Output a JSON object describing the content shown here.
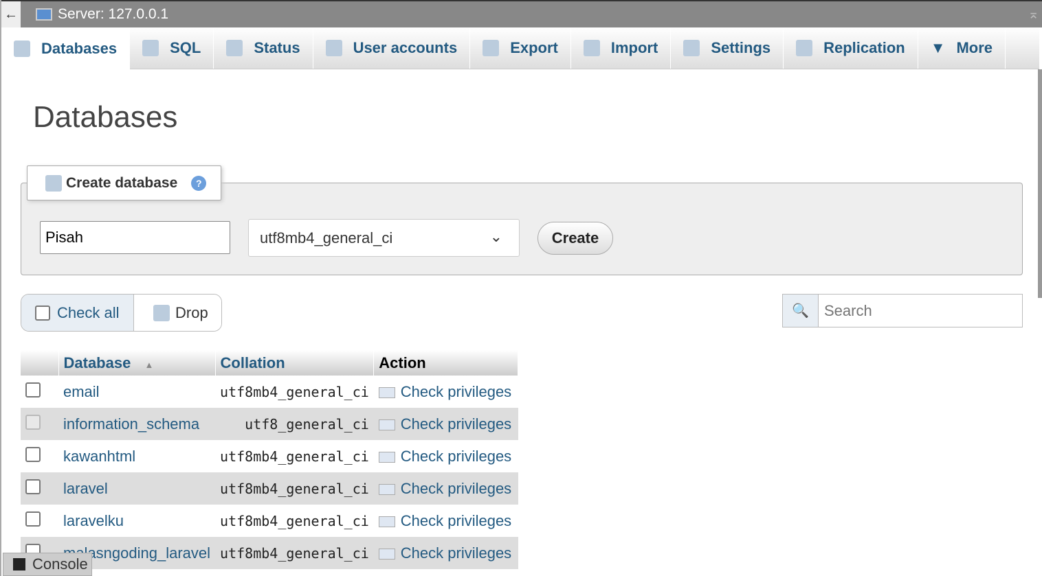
{
  "topbar": {
    "back": "←",
    "title": "Server: 127.0.0.1",
    "collapse": "⌅"
  },
  "tabs": [
    {
      "label": "Databases"
    },
    {
      "label": "SQL"
    },
    {
      "label": "Status"
    },
    {
      "label": "User accounts"
    },
    {
      "label": "Export"
    },
    {
      "label": "Import"
    },
    {
      "label": "Settings"
    },
    {
      "label": "Replication"
    },
    {
      "label": "More"
    }
  ],
  "page_title": "Databases",
  "create": {
    "legend": "Create database",
    "help": "?",
    "name_value": "Pisah",
    "collation": "utf8mb4_general_ci",
    "button": "Create"
  },
  "actions": {
    "check_all": "Check all",
    "drop": "Drop",
    "search_placeholder": "Search"
  },
  "table": {
    "headers": [
      "Database",
      "Collation",
      "Action"
    ],
    "sort_indicator": "▲",
    "rows": [
      {
        "name": "email",
        "collation": "utf8mb4_general_ci",
        "action": "Check privileges"
      },
      {
        "name": "information_schema",
        "collation": "utf8_general_ci",
        "action": "Check privileges"
      },
      {
        "name": "kawanhtml",
        "collation": "utf8mb4_general_ci",
        "action": "Check privileges"
      },
      {
        "name": "laravel",
        "collation": "utf8mb4_general_ci",
        "action": "Check privileges"
      },
      {
        "name": "laravelku",
        "collation": "utf8mb4_general_ci",
        "action": "Check privileges"
      },
      {
        "name": "malasngoding_laravel",
        "collation": "utf8mb4_general_ci",
        "action": "Check privileges"
      }
    ]
  },
  "console": "Console"
}
